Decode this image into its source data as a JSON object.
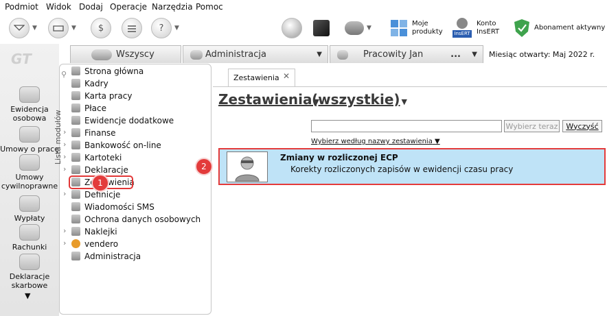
{
  "menubar": [
    "Podmiot",
    "Widok",
    "Dodaj",
    "Operacje",
    "Narzędzia",
    "Pomoc"
  ],
  "toolbar": {
    "moje_produkty": "Moje\nprodukty",
    "konto": "Konto\nInsERT",
    "abonament": "Abonament aktywny",
    "insert_logo": "InsERT"
  },
  "logo_text": "GT",
  "rail": [
    {
      "label": "Ewidencja\nosobowa"
    },
    {
      "label": "Umowy o pracę"
    },
    {
      "label": "Umowy\ncywilnoprawne"
    },
    {
      "label": "Wypłaty"
    },
    {
      "label": "Rachunki"
    },
    {
      "label": "Deklaracje\nskarbowe"
    }
  ],
  "tabs": {
    "wszyscy": "Wszyscy",
    "administracja": "Administracja",
    "pracowity": "Pracowity Jan",
    "more": "..."
  },
  "month_open": "Miesiąc otwarty:  Maj 2022 r.",
  "module_panel": {
    "vertical_label": "Lista modułów",
    "items": [
      {
        "label": "Strona główna"
      },
      {
        "label": "Kadry"
      },
      {
        "label": "Karta pracy"
      },
      {
        "label": "Płace"
      },
      {
        "label": "Ewidencje dodatkowe"
      },
      {
        "label": "Finanse"
      },
      {
        "label": "Bankowość on-line"
      },
      {
        "label": "Kartoteki"
      },
      {
        "label": "Deklaracje"
      },
      {
        "label": "Zestawienia"
      },
      {
        "label": "Definicje"
      },
      {
        "label": "Wiadomości SMS"
      },
      {
        "label": "Ochrona danych osobowych"
      },
      {
        "label": "Naklejki"
      },
      {
        "label": "vendero"
      },
      {
        "label": "Administracja"
      }
    ]
  },
  "content": {
    "tab_label": "Zestawienia",
    "heading1": "Zestawienia",
    "heading2": "(wszystkie)",
    "search_placeholder": "",
    "btn_choose": "Wybierz teraz",
    "btn_clear": "Wyczyść",
    "hint": "Wybierz według nazwy zestawienia",
    "row": {
      "title": "Zmiany w rozliczonej ECP",
      "desc": "Korekty rozliczonych zapisów w ewidencji czasu pracy"
    }
  },
  "badges": [
    "1",
    "2"
  ],
  "colors": {
    "selection": "#bfe3f7",
    "highlight": "#e43a3a",
    "badge": "#e33b3b"
  }
}
